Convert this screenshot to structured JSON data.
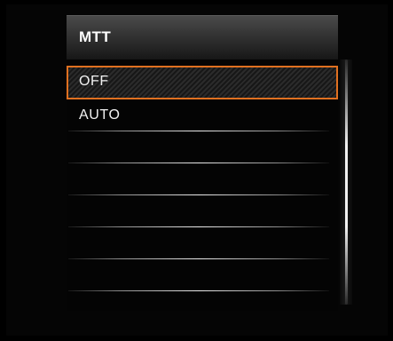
{
  "menu": {
    "title": "MTT",
    "selected_index": 0,
    "items": [
      {
        "label": "OFF"
      },
      {
        "label": "AUTO"
      },
      {
        "label": ""
      },
      {
        "label": ""
      },
      {
        "label": ""
      },
      {
        "label": ""
      },
      {
        "label": ""
      }
    ]
  },
  "colors": {
    "background": "#000000",
    "highlight_border": "#e07020",
    "text": "#f2f2f2"
  }
}
